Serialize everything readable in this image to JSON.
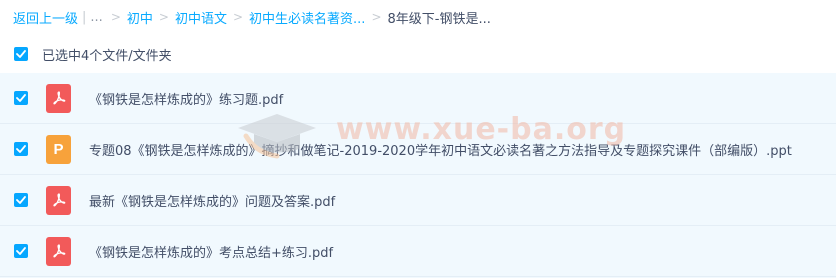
{
  "breadcrumb": {
    "back": "返回上一级",
    "ellipsis": "...",
    "items": [
      "初中",
      "初中语文",
      "初中生必读名著资..."
    ],
    "current": "8年级下-钢铁是..."
  },
  "selection": {
    "text": "已选中4个文件/文件夹",
    "checked": true
  },
  "files": [
    {
      "type": "pdf",
      "icon": "pdf-icon",
      "name": "《钢铁是怎样炼成的》练习题.pdf",
      "checked": true
    },
    {
      "type": "ppt",
      "icon": "ppt-icon",
      "icon_letter": "P",
      "name": "专题08《钢铁是怎样炼成的》摘抄和做笔记-2019-2020学年初中语文必读名著之方法指导及专题探究课件（部编版）.ppt",
      "checked": true
    },
    {
      "type": "pdf",
      "icon": "pdf-icon",
      "name": "最新《钢铁是怎样炼成的》问题及答案.pdf",
      "checked": true
    },
    {
      "type": "pdf",
      "icon": "pdf-icon",
      "name": "《钢铁是怎样炼成的》考点总结+练习.pdf",
      "checked": true
    }
  ],
  "watermark": {
    "text": "www.xue-ba.org"
  },
  "colors": {
    "accent": "#09aaff",
    "checkbox": "#06a7ff",
    "pdf": "#f25a5a",
    "ppt": "#f7a23b",
    "text": "#424e67",
    "list_bg": "#f1f9fe"
  }
}
